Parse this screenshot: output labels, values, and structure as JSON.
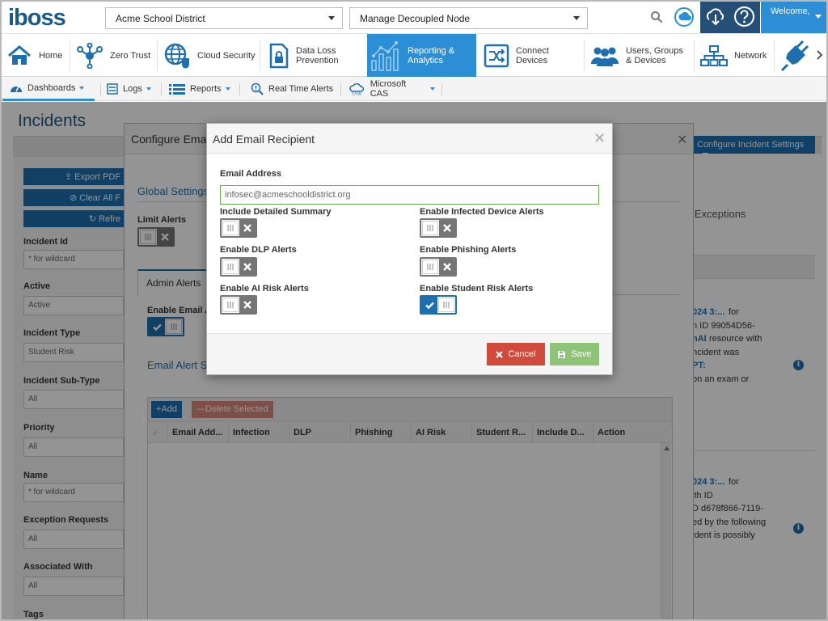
{
  "header": {
    "logo": "iboss",
    "district_select": "Acme School District",
    "node_select": "Manage Decoupled Node",
    "welcome": "Welcome,"
  },
  "nav": {
    "items": [
      {
        "label": "Home"
      },
      {
        "label": "Zero Trust"
      },
      {
        "label": "Cloud Security"
      },
      {
        "label": "Data Loss Prevention"
      },
      {
        "label": "Reporting & Analytics"
      },
      {
        "label": "Connect Devices"
      },
      {
        "label": "Users, Groups & Devices"
      },
      {
        "label": "Network"
      }
    ]
  },
  "subnav": {
    "items": [
      {
        "label": "Dashboards"
      },
      {
        "label": "Logs"
      },
      {
        "label": "Reports"
      },
      {
        "label": "Real Time Alerts"
      },
      {
        "label": "Microsoft CAS"
      }
    ]
  },
  "page": {
    "title": "Incidents",
    "buttons": [
      "Export PDF",
      "Clear All F",
      "Refre"
    ],
    "filters": [
      {
        "label": "Incident Id",
        "value": "* for wildcard"
      },
      {
        "label": "Active",
        "value": "Active"
      },
      {
        "label": "Incident Type",
        "value": "Student Risk"
      },
      {
        "label": "Incident Sub-Type",
        "value": "All"
      },
      {
        "label": "Priority",
        "value": "All"
      },
      {
        "label": "Name",
        "value": "* for wildcard"
      },
      {
        "label": "Exception Requests",
        "value": "All"
      },
      {
        "label": "Associated With",
        "value": "All"
      },
      {
        "label": "Tags",
        "value": ""
      }
    ],
    "configure_settings_button": "Configure Incident Settings",
    "exceptions_label": "e Exceptions",
    "incident_fragments_1": [
      "024 3:...",
      "for",
      "n ID 99054D56-",
      "nAI",
      "resource with",
      "ncident was",
      "PT:",
      "on an exam or"
    ],
    "incident_fragments_2": [
      "024 3:...",
      "for",
      "ith ID",
      "D d678f866-7119-",
      "ed by the following",
      "ident is possibly"
    ]
  },
  "configure_modal": {
    "title": "Configure Ema",
    "global_settings": "Global Settings",
    "limit_alerts": "Limit Alerts",
    "admin_alerts_tab": "Admin Alerts",
    "enable_email": "Enable Email A",
    "email_alert_section": "Email Alert S",
    "add_button": "Add",
    "delete_button": "Delete Selected",
    "columns": [
      "Email Add...",
      "Infection",
      "DLP",
      "Phishing",
      "AI Risk",
      "Student R...",
      "Include D...",
      "Action"
    ]
  },
  "dialog": {
    "title": "Add Email Recipient",
    "email_label": "Email Address",
    "email_value": "infosec@acmeschooldistrict.org",
    "toggles": [
      {
        "label": "Include Detailed Summary",
        "on": false
      },
      {
        "label": "Enable Infected Device Alerts",
        "on": false
      },
      {
        "label": "Enable DLP Alerts",
        "on": false
      },
      {
        "label": "Enable Phishing Alerts",
        "on": false
      },
      {
        "label": "Enable AI Risk Alerts",
        "on": false
      },
      {
        "label": "Enable Student Risk Alerts",
        "on": true
      }
    ],
    "cancel": "Cancel",
    "save": "Save"
  },
  "colors": {
    "brand_blue": "#1a5b86",
    "accent_blue": "#2c8fd6",
    "cancel_red": "#d14b3c",
    "save_green": "#8fc378"
  }
}
